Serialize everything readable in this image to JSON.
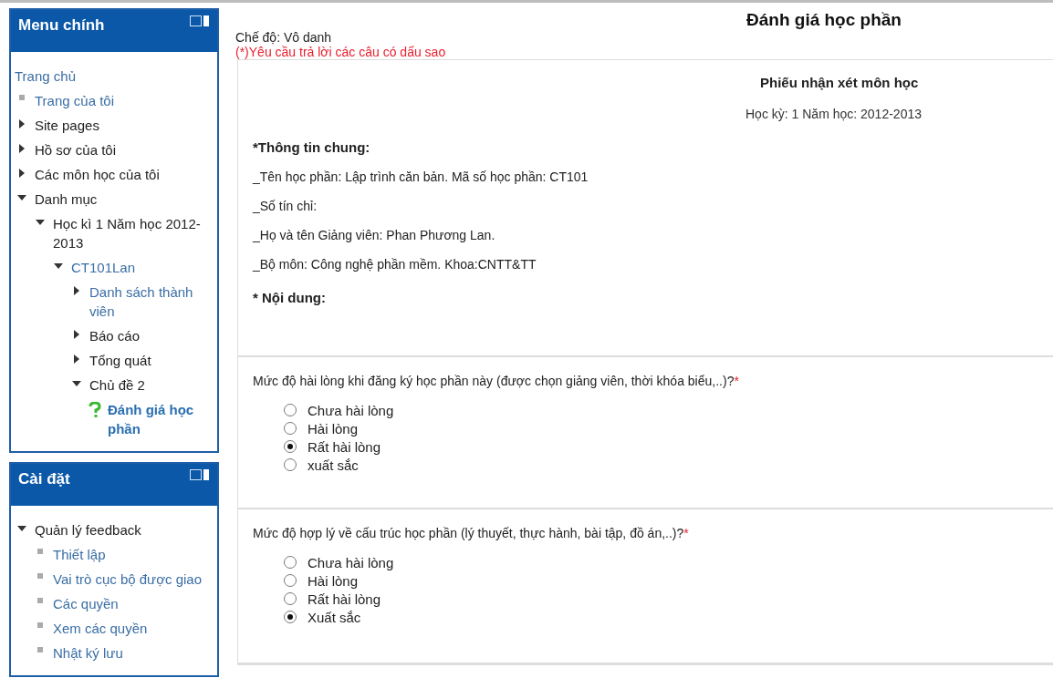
{
  "sidebar": {
    "blocks": [
      {
        "title": "Menu chính",
        "items": [
          {
            "kind": "home",
            "label": "Trang chủ"
          },
          {
            "kind": "page",
            "label": "Trang của tôi"
          },
          {
            "kind": "branch",
            "label": "Site pages",
            "expanded": false
          },
          {
            "kind": "branch",
            "label": "Hồ sơ của tôi",
            "expanded": false
          },
          {
            "kind": "branch",
            "label": "Các môn học của tôi",
            "expanded": false
          },
          {
            "kind": "branch",
            "label": "Danh mục",
            "expanded": true,
            "children": [
              {
                "kind": "branch",
                "label": "Học kì 1 Năm học 2012-2013",
                "expanded": true,
                "children": [
                  {
                    "kind": "link-branch",
                    "label": "CT101Lan",
                    "expanded": true,
                    "children": [
                      {
                        "kind": "link-branch",
                        "label": "Danh sách thành viên",
                        "expanded": false
                      },
                      {
                        "kind": "branch",
                        "label": "Báo cáo",
                        "expanded": false
                      },
                      {
                        "kind": "branch",
                        "label": "Tổng quát",
                        "expanded": false
                      },
                      {
                        "kind": "branch",
                        "label": "Chủ đề 2",
                        "expanded": true,
                        "children": [
                          {
                            "kind": "activity",
                            "label": "Đánh giá học phần"
                          }
                        ]
                      }
                    ]
                  }
                ]
              }
            ]
          }
        ]
      },
      {
        "title": "Cài đặt",
        "items": [
          {
            "kind": "branch",
            "label": "Quản lý feedback",
            "expanded": true,
            "children": [
              {
                "kind": "page",
                "label": "Thiết lập"
              },
              {
                "kind": "page",
                "label": "Vai trò cục bộ được giao"
              },
              {
                "kind": "page",
                "label": "Các quyền"
              },
              {
                "kind": "page",
                "label": "Xem các quyền"
              },
              {
                "kind": "page",
                "label": "Nhật ký lưu"
              }
            ]
          }
        ]
      }
    ]
  },
  "main": {
    "title": "Đánh giá học phần",
    "mode": "Chế độ: Vô danh",
    "required_note": "(*)Yêu cầu trả lời các câu có dấu sao",
    "form": {
      "heading": "Phiếu nhận xét môn học",
      "term": "Học kỳ: 1 Năm học: 2012-2013",
      "info": [
        {
          "kind": "heading",
          "text": "*Thông tin chung:"
        },
        {
          "kind": "line",
          "text": "_Tên học phần: Lập trình căn bản. Mã số học phần: CT101"
        },
        {
          "kind": "line",
          "text": "_Số tín chỉ:"
        },
        {
          "kind": "line",
          "text": "_Họ và tên Giảng viên: Phan Phương Lan."
        },
        {
          "kind": "line",
          "text": "_Bộ môn: Công nghệ phần mềm. Khoa:CNTT&TT"
        },
        {
          "kind": "heading",
          "text": "* Nội dung:"
        }
      ],
      "questions": [
        {
          "text": "Mức độ hài lòng khi đăng ký học phần này (được chọn giảng viên, thời khóa biểu,..)?",
          "required_mark": "*",
          "options": [
            {
              "label": "Chưa hài lòng",
              "selected": false
            },
            {
              "label": "Hài lòng",
              "selected": false
            },
            {
              "label": "Rất hài lòng",
              "selected": true
            },
            {
              "label": "xuất sắc",
              "selected": false
            }
          ]
        },
        {
          "text": "Mức độ hợp lý về cấu trúc học phần (lý thuyết, thực hành, bài tập, đồ án,..)?",
          "required_mark": "*",
          "options": [
            {
              "label": "Chưa hài lòng",
              "selected": false
            },
            {
              "label": "Hài lòng",
              "selected": false
            },
            {
              "label": "Rất hài lòng",
              "selected": false
            },
            {
              "label": "Xuất sắc",
              "selected": true
            }
          ]
        }
      ]
    }
  }
}
